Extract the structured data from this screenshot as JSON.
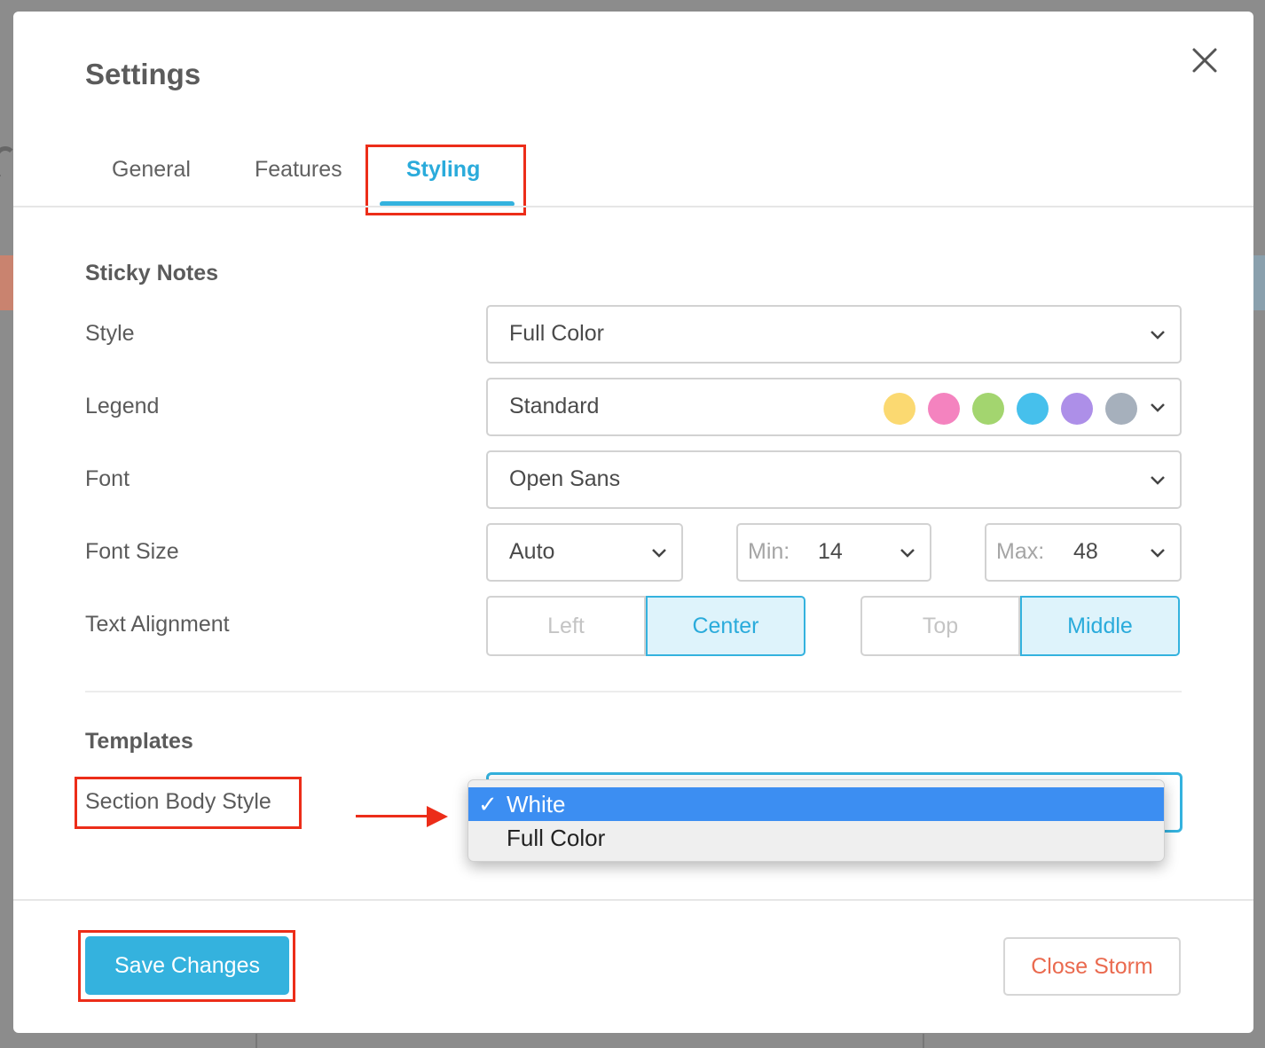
{
  "dialog": {
    "title": "Settings",
    "close_icon": "close-icon"
  },
  "tabs": [
    {
      "label": "General",
      "active": false
    },
    {
      "label": "Features",
      "active": false
    },
    {
      "label": "Styling",
      "active": true
    }
  ],
  "sticky_notes": {
    "heading": "Sticky Notes",
    "style": {
      "label": "Style",
      "value": "Full Color"
    },
    "legend": {
      "label": "Legend",
      "value": "Standard",
      "colors": [
        "#fbd971",
        "#f483bf",
        "#a3d56f",
        "#46c0ec",
        "#ad8fe8",
        "#a6b0bc"
      ]
    },
    "font": {
      "label": "Font",
      "value": "Open Sans"
    },
    "font_size": {
      "label": "Font Size",
      "mode": "Auto",
      "min_label": "Min:",
      "min_value": "14",
      "max_label": "Max:",
      "max_value": "48"
    },
    "text_alignment": {
      "label": "Text Alignment",
      "horizontal": [
        {
          "label": "Left",
          "active": false
        },
        {
          "label": "Center",
          "active": true
        }
      ],
      "vertical": [
        {
          "label": "Top",
          "active": false
        },
        {
          "label": "Middle",
          "active": true
        }
      ]
    }
  },
  "templates": {
    "heading": "Templates",
    "section_body_style": {
      "label": "Section Body Style",
      "options": [
        {
          "label": "White",
          "selected": true,
          "check": "✓"
        },
        {
          "label": "Full Color",
          "selected": false
        }
      ]
    }
  },
  "footer": {
    "save_label": "Save Changes",
    "close_label": "Close Storm"
  },
  "colors": {
    "accent": "#34b2de",
    "annotation_red": "#ec2d19",
    "danger_text": "#ea6a4f",
    "dropdown_highlight": "#3c8ef2"
  }
}
